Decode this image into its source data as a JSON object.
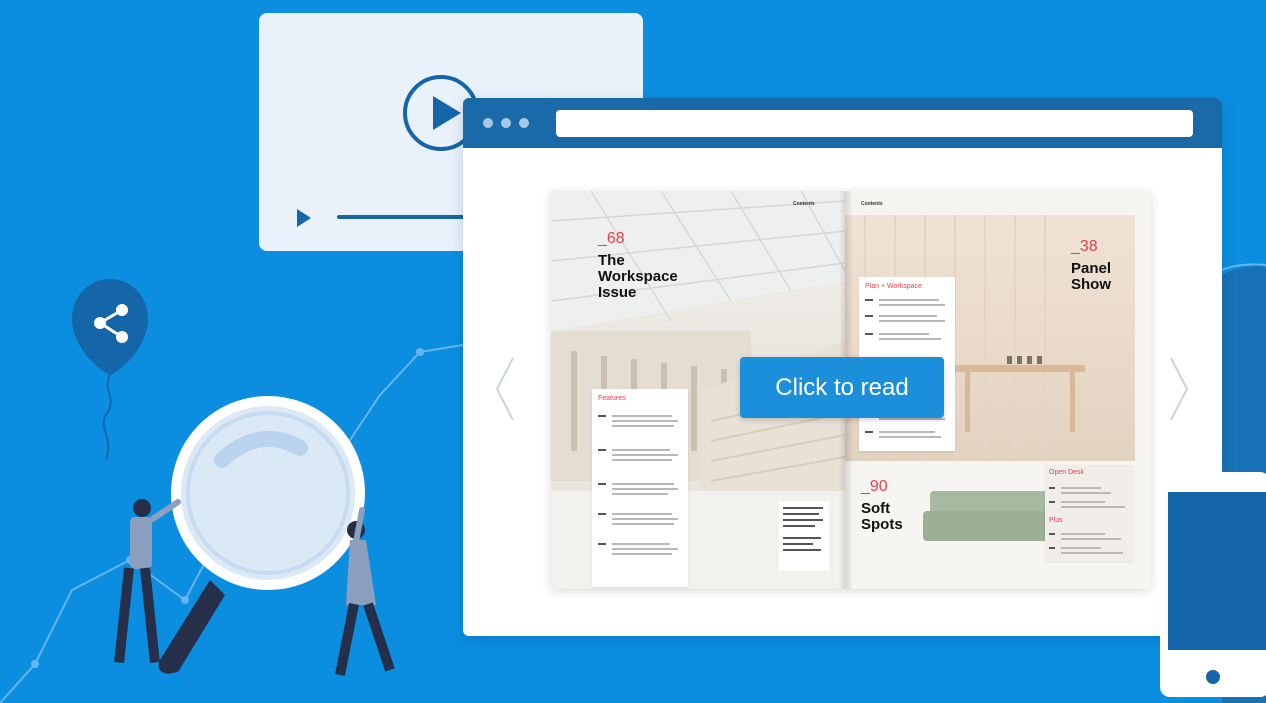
{
  "page": {
    "background_color": "#0b8ee0",
    "accent_color": "#1c8fdb",
    "browser_bar_color": "#1a6aa9"
  },
  "video_card": {
    "icon": "play-circle-icon",
    "progress_icon": "play-icon"
  },
  "browser": {
    "dots": 3,
    "address_bar_value": ""
  },
  "magazine": {
    "left_page": {
      "header_left": "",
      "header_right": "Contents",
      "feature_number": "_68",
      "feature_title": [
        "The",
        "Workspace",
        "Issue"
      ],
      "toc_heading": "Features"
    },
    "right_page": {
      "header_left": "Contents",
      "feature_number_1": "_38",
      "feature_title_1": [
        "Panel",
        "Show"
      ],
      "toc_heading": "Plan + Workspace",
      "feature_number_2": "_90",
      "feature_title_2": [
        "Soft",
        "Spots"
      ],
      "side_box_heading_1": "Open Desk",
      "side_box_heading_2": "Plus"
    }
  },
  "read_button": {
    "label": "Click to read"
  },
  "icons": {
    "share": "share-icon",
    "magnifier": "magnifier-icon",
    "prev": "chevron-left-icon",
    "next": "chevron-right-icon"
  }
}
